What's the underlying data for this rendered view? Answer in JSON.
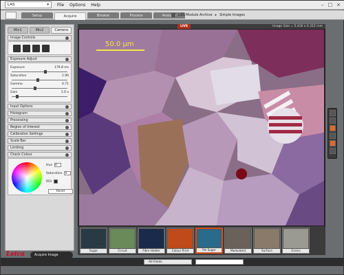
{
  "menubar": {
    "app": "LAS",
    "menus": [
      "File",
      "Options",
      "Help"
    ]
  },
  "modules": {
    "tabs": [
      "Setup",
      "Acquire",
      "Browse",
      "Process",
      "Analysis"
    ],
    "active": "Acquire"
  },
  "breadcrumb": {
    "items": [
      "LAS Module Archive",
      "Simple Images"
    ]
  },
  "left_panel": {
    "mic_tabs": [
      "Mic1",
      "Mic2",
      "Camera"
    ],
    "image_controls_title": "Image Controls",
    "exposure_title": "Exposure Adjust",
    "exposure": {
      "label": "Exposure",
      "value": "179.8 ms"
    },
    "saturation": {
      "label": "Saturation",
      "value": "1.90"
    },
    "gamma": {
      "label": "Gamma",
      "value": "0.71"
    },
    "gain": {
      "label": "Gain",
      "value": "1.0 x"
    },
    "sections": [
      "Input Options",
      "Histogram",
      "Processing",
      "Region of Interest",
      "Calibration Settings",
      "Scale Bar",
      "Limiting",
      "Check Colour"
    ],
    "colour": {
      "hue_label": "Hue",
      "hue": "0",
      "saturation_label": "Saturation",
      "saturation": "0",
      "roi_label": "ROI",
      "reset": "Reset"
    }
  },
  "image": {
    "live": "LIVE",
    "image_size": "Image Size = 5.416 x 0.312 mm",
    "scale": "50.0 µm"
  },
  "thumbnails": [
    "Sugar",
    "Circuit",
    "Fibre Holder",
    "Colour Print",
    "Pol Sugar",
    "Modulated",
    "Surface",
    "Grains"
  ],
  "selected_thumbnail": "Pol Sugar",
  "bottom": {
    "logo": "Leica",
    "acquire": "Acquire Image",
    "fields": "All Fields"
  },
  "colors": {
    "live": "#b03020",
    "accent": "#e06a2a",
    "logo": "#e2001a"
  }
}
